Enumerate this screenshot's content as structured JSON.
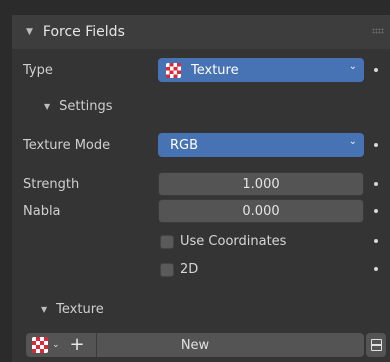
{
  "panel": {
    "title": "Force Fields"
  },
  "type_row": {
    "label": "Type",
    "value": "Texture",
    "icon": "texture-checker-icon"
  },
  "settings": {
    "header": "Settings",
    "texture_mode": {
      "label": "Texture Mode",
      "value": "RGB"
    },
    "strength": {
      "label": "Strength",
      "value": "1.000"
    },
    "nabla": {
      "label": "Nabla",
      "value": "0.000"
    },
    "use_coordinates": {
      "label": "Use Coordinates",
      "checked": false
    },
    "two_d": {
      "label": "2D",
      "checked": false
    }
  },
  "texture": {
    "header": "Texture",
    "new_label": "New"
  },
  "colors": {
    "accent": "#4772b3",
    "panel_bg": "#343434",
    "header_bg": "#3d3d3d",
    "texture_red": "#d9293b"
  }
}
